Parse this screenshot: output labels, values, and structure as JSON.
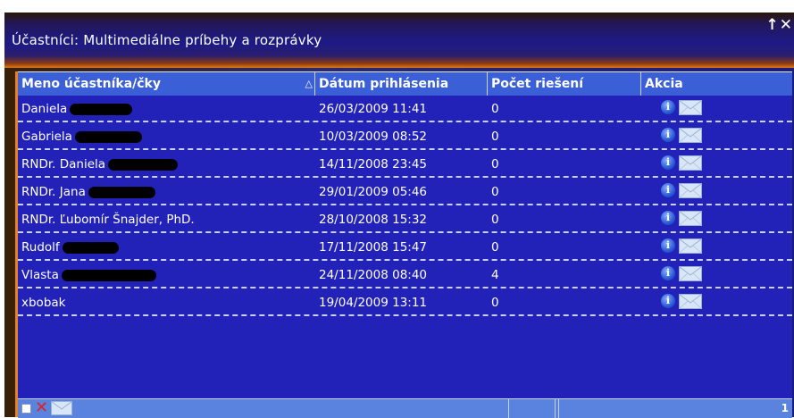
{
  "window": {
    "title": "Účastníci: Multimediálne príbehy a rozprávky",
    "controls": {
      "maximize": "↑",
      "close": "✕"
    }
  },
  "table": {
    "columns": [
      {
        "label": "Meno účastníka/čky",
        "sort_indicator": "△"
      },
      {
        "label": "Dátum prihlásenia"
      },
      {
        "label": "Počet riešení"
      },
      {
        "label": "Akcia"
      }
    ],
    "rows": [
      {
        "name": "Daniela",
        "redacted": true,
        "date": "26/03/2009 11:41",
        "count": "0"
      },
      {
        "name": "Gabriela",
        "redacted": true,
        "date": "10/03/2009 08:52",
        "count": "0"
      },
      {
        "name": "RNDr. Daniela",
        "redacted": true,
        "date": "14/11/2008 23:45",
        "count": "0"
      },
      {
        "name": "RNDr. Jana",
        "redacted": true,
        "date": "29/01/2009 05:46",
        "count": "0"
      },
      {
        "name": "RNDr. Ľubomír Šnajder, PhD.",
        "redacted": false,
        "date": "28/10/2008 15:32",
        "count": "0"
      },
      {
        "name": "Rudolf",
        "redacted": true,
        "date": "17/11/2008 15:47",
        "count": "0"
      },
      {
        "name": "Vlasta",
        "redacted": true,
        "date": "24/11/2008 08:40",
        "count": "4"
      },
      {
        "name": "xbobak",
        "redacted": false,
        "date": "19/04/2009 13:11",
        "count": "0"
      }
    ],
    "action_icons": [
      "info-icon",
      "mail-icon"
    ]
  },
  "footer": {
    "icons": [
      "checkbox",
      "delete-icon",
      "mail-icon"
    ],
    "delete_glyph": "✕",
    "page_number": "1"
  },
  "colors": {
    "accent": "#e8821c",
    "header": "#3a5fd6",
    "panel": "#2222b8",
    "footer": "#5a83e0",
    "delete": "#e02020"
  }
}
